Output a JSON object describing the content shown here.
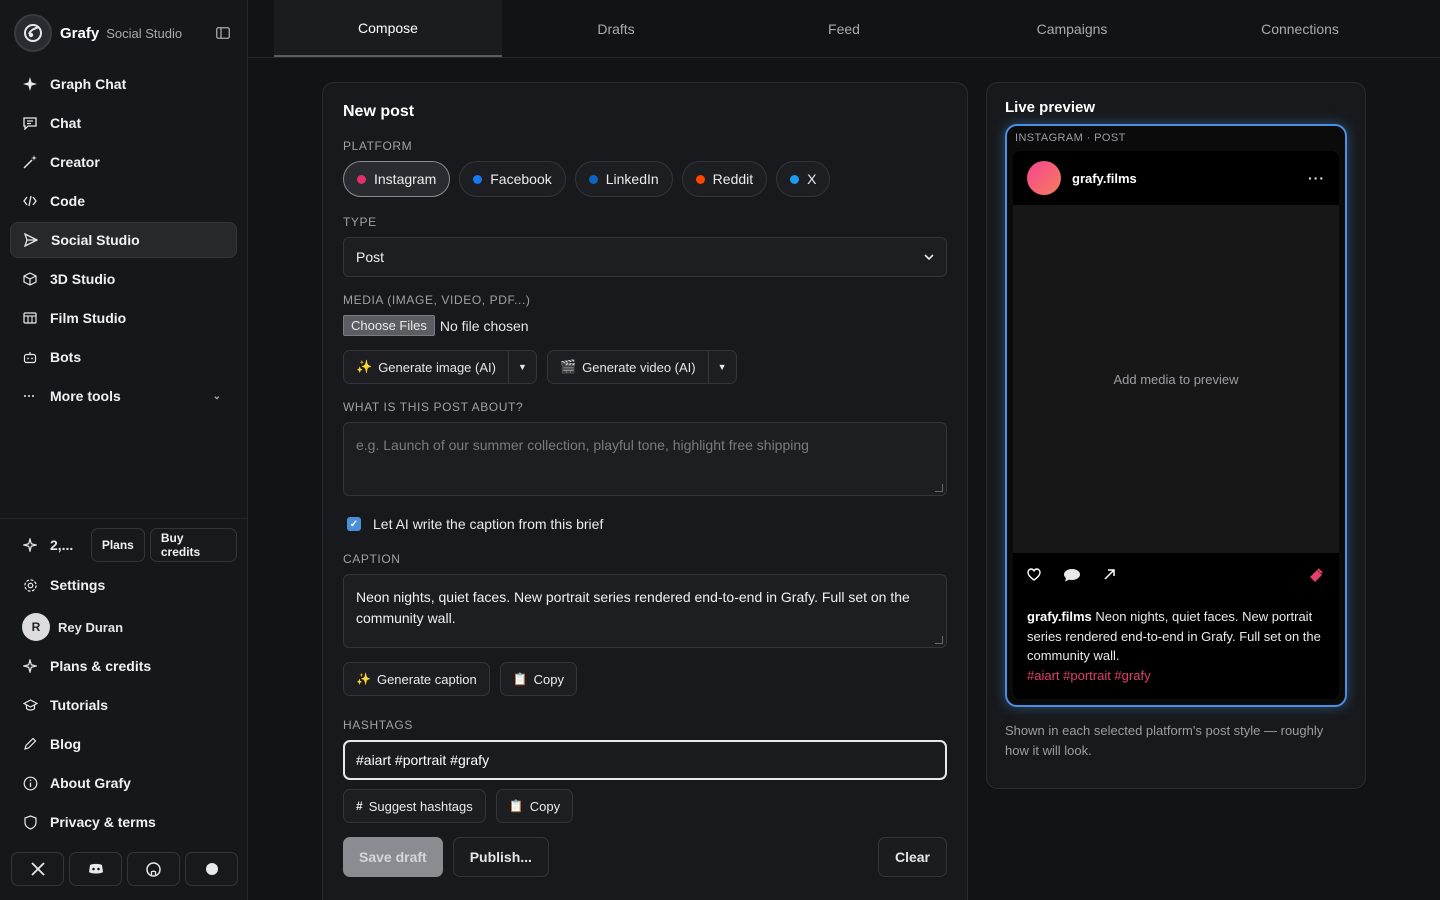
{
  "brand": {
    "name": "Grafy",
    "subtitle": "Social Studio"
  },
  "nav": [
    {
      "label": "Graph Chat",
      "icon": "sparkle-icon"
    },
    {
      "label": "Chat",
      "icon": "chat-icon"
    },
    {
      "label": "Creator",
      "icon": "magic-wand-icon"
    },
    {
      "label": "Code",
      "icon": "code-icon"
    },
    {
      "label": "Social Studio",
      "icon": "send-icon",
      "active": true
    },
    {
      "label": "3D Studio",
      "icon": "cube-icon"
    },
    {
      "label": "Film Studio",
      "icon": "film-icon"
    },
    {
      "label": "Bots",
      "icon": "bot-icon"
    },
    {
      "label": "More tools",
      "icon": "more-icon"
    }
  ],
  "credits": {
    "value": "2,...",
    "plans_label": "Plans",
    "buy_label": "Buy credits"
  },
  "bottom_nav": {
    "settings": "Settings",
    "user_initial": "R",
    "user_name": "Rey Duran",
    "plans_credits": "Plans & credits",
    "tutorials": "Tutorials",
    "blog": "Blog",
    "about": "About Grafy",
    "privacy": "Privacy & terms"
  },
  "tabs": [
    "Compose",
    "Drafts",
    "Feed",
    "Campaigns",
    "Connections"
  ],
  "compose": {
    "title": "New post",
    "platform_label": "PLATFORM",
    "platforms": [
      {
        "label": "Instagram",
        "color": "#e1306c",
        "active": true
      },
      {
        "label": "Facebook",
        "color": "#1877f2"
      },
      {
        "label": "LinkedIn",
        "color": "#0a66c2"
      },
      {
        "label": "Reddit",
        "color": "#ff4500"
      },
      {
        "label": "X",
        "color": "#1d9bf0"
      }
    ],
    "type_label": "TYPE",
    "type_value": "Post",
    "media_label": "MEDIA (IMAGE, VIDEO, PDF...)",
    "file_button": "Choose Files",
    "file_status": "No file chosen",
    "gen_image": "Generate image (AI)",
    "gen_video": "Generate video (AI)",
    "about_label": "WHAT IS THIS POST ABOUT?",
    "about_placeholder": "e.g. Launch of our summer collection, playful tone, highlight free shipping",
    "ai_caption_check": "Let AI write the caption from this brief",
    "caption_label": "CAPTION",
    "caption_value": "Neon nights, quiet faces. New portrait series rendered end-to-end in Grafy. Full set on the community wall.",
    "gen_caption": "Generate caption",
    "copy_label": "Copy",
    "hashtags_label": "HASHTAGS",
    "hashtags_value": "#aiart #portrait #grafy",
    "suggest_hashtags": "Suggest hashtags",
    "save_draft": "Save draft",
    "publish": "Publish...",
    "clear": "Clear"
  },
  "preview": {
    "title": "Live preview",
    "tag": "INSTAGRAM · POST",
    "username": "grafy.films",
    "more": "···",
    "media_placeholder": "Add media to preview",
    "caption_user": "grafy.films",
    "caption_text": "Neon nights, quiet faces. New portrait series rendered end-to-end in Grafy. Full set on the community wall.",
    "tags": "#aiart #portrait #grafy",
    "note": "Shown in each selected platform's post style — roughly how it will look."
  }
}
